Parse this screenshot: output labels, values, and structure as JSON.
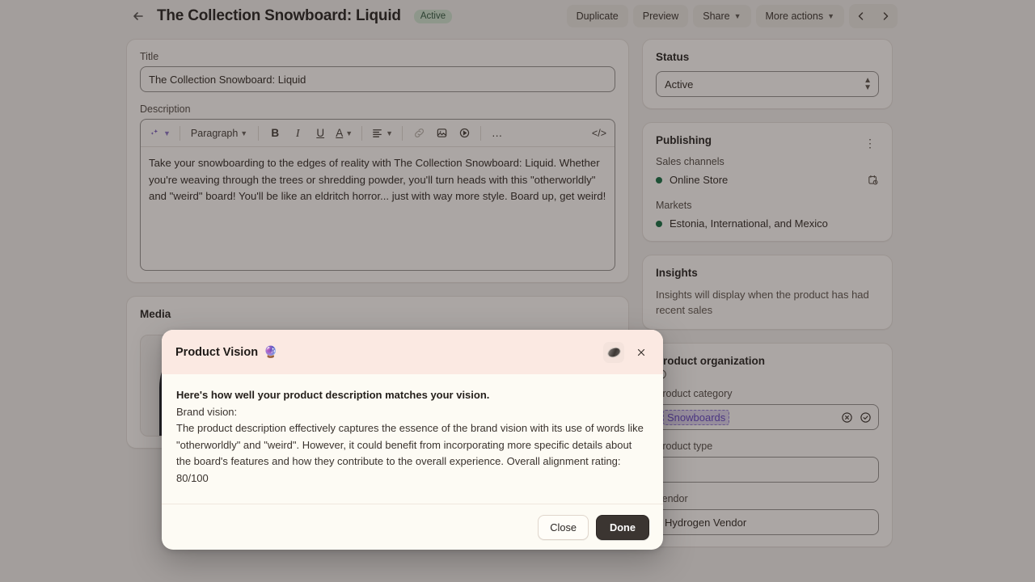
{
  "topbar": {
    "back_icon": "arrow-left-icon",
    "title": "The Collection Snowboard: Liquid",
    "status_badge": "Active",
    "duplicate": "Duplicate",
    "preview": "Preview",
    "share": "Share",
    "more_actions": "More actions",
    "prev_icon": "chevron-left-icon",
    "next_icon": "chevron-right-icon"
  },
  "product_form": {
    "title_label": "Title",
    "title_value": "The Collection Snowboard: Liquid",
    "description_label": "Description",
    "toolbar": {
      "ai_icon": "sparkle-icon",
      "block_style": "Paragraph",
      "bold": "B",
      "italic": "I",
      "underline": "U",
      "text_color": "A",
      "align": "align-left-icon",
      "link": "link-icon",
      "image": "image-icon",
      "video": "video-icon",
      "more": "…",
      "code": "</>"
    },
    "description_text": "Take your snowboarding to the edges of reality with The Collection Snowboard: Liquid. Whether you're weaving through the trees or shredding powder, you'll turn heads with this \"otherworldly\" and \"weird\" board! You'll be like an eldritch horror... just with way more style. Board up, get weird!"
  },
  "media": {
    "title": "Media"
  },
  "status_card": {
    "title": "Status",
    "value": "Active"
  },
  "publishing": {
    "title": "Publishing",
    "menu_icon": "kebab-menu-icon",
    "sales_channels_label": "Sales channels",
    "channel": "Online Store",
    "channel_icon": "calendar-clock-icon",
    "markets_label": "Markets",
    "market": "Estonia, International, and Mexico",
    "dot_color": "#0B6B41"
  },
  "insights": {
    "title": "Insights",
    "empty_text": "Insights will display when the product has had recent sales"
  },
  "product_organization": {
    "title": "Product organization",
    "info_icon": "info-circle-icon",
    "category_label": "Product category",
    "category_value": "Snowboards",
    "clear_icon": "circle-x-icon",
    "confirm_icon": "circle-check-icon",
    "type_label": "Product type",
    "type_value": "",
    "vendor_label": "Vendor",
    "vendor_value": "Hydrogen Vendor"
  },
  "modal": {
    "title": "Product Vision",
    "title_emoji": "🔮",
    "oval_icon": "oval-stone-icon",
    "close_icon": "close-icon",
    "heading": "Here's how well your product description matches your vision.",
    "subheading": "Brand vision:",
    "body": "The product description effectively captures the essence of the brand vision with its use of words like \"otherworldly\" and \"weird\". However, it could benefit from incorporating more specific details about the board's features and how they contribute to the overall experience. Overall alignment rating:",
    "rating": "80/100",
    "close_label": "Close",
    "done_label": "Done"
  }
}
